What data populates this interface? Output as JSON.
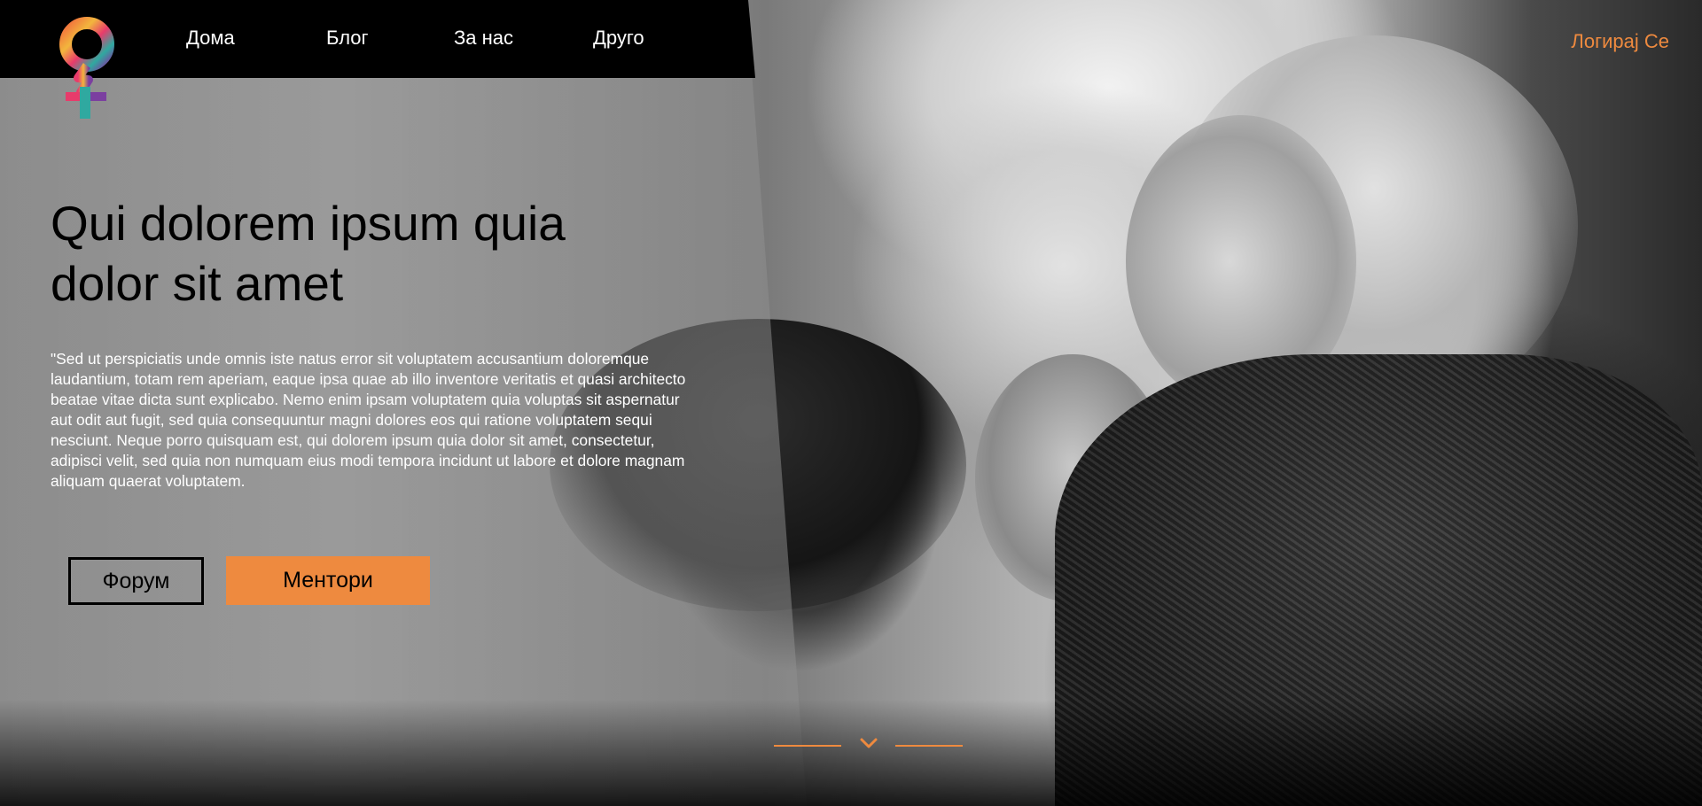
{
  "nav": {
    "items": [
      {
        "label": "Дома"
      },
      {
        "label": "Блог"
      },
      {
        "label": "За нас"
      },
      {
        "label": "Друго"
      }
    ],
    "login_label": "Логирај Се"
  },
  "hero": {
    "headline": "Qui dolorem ipsum quia dolor sit amet",
    "paragraph": "\"Sed ut perspiciatis unde omnis iste natus error sit voluptatem accusantium doloremque laudantium, totam rem aperiam, eaque ipsa quae ab illo inventore veritatis et quasi architecto beatae vitae dicta sunt explicabo. Nemo enim ipsam voluptatem quia voluptas sit aspernatur aut odit aut fugit, sed quia consequuntur magni dolores eos qui ratione voluptatem sequi nesciunt. Neque porro quisquam est, qui dolorem ipsum quia dolor sit amet, consectetur, adipisci velit, sed quia non numquam eius modi tempora incidunt ut labore et dolore magnam aliquam quaerat voluptatem.",
    "buttons": {
      "forum": "Форум",
      "mentors": "Ментори"
    }
  },
  "icons": {
    "logo": "venus-symbol-logo",
    "scroll": "chevron-down-icon"
  },
  "colors": {
    "accent": "#ee8a3f",
    "navbar": "#000000",
    "text_dark": "#000000",
    "text_light": "#ffffff"
  }
}
